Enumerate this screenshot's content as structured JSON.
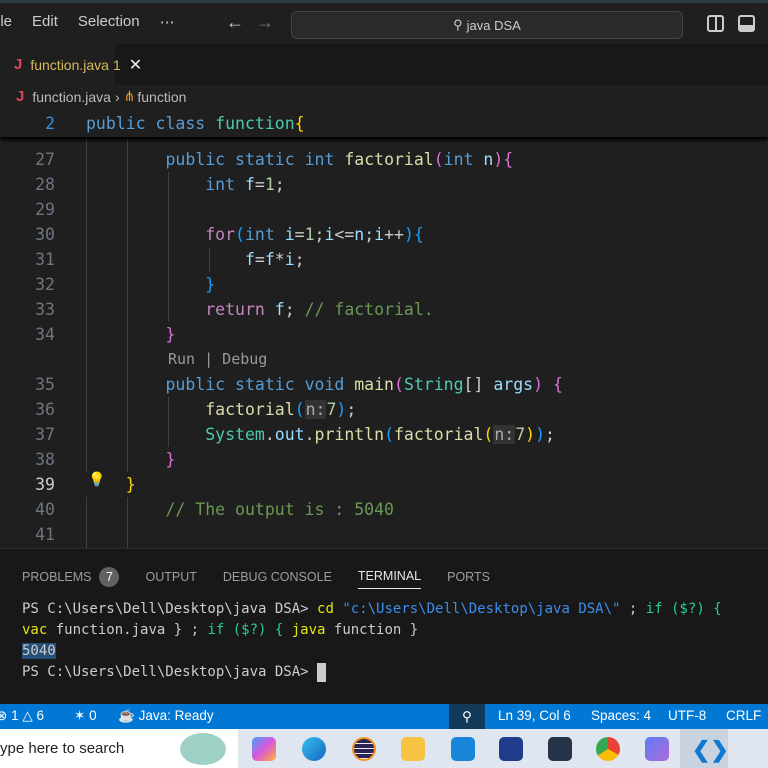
{
  "menu": [
    "ile",
    "Edit",
    "Selection",
    "⋯"
  ],
  "search": "java DSA",
  "tab": {
    "icon": "J",
    "name": "function.java",
    "problems": "1",
    "close": "✕"
  },
  "breadcrumb": {
    "file": "function.java",
    "symbol": "function"
  },
  "sticky": {
    "ln": "2",
    "tokens": [
      [
        "public ",
        "k"
      ],
      [
        "class ",
        "k"
      ],
      [
        "function",
        "t"
      ],
      [
        "{",
        "b1"
      ]
    ]
  },
  "lines": [
    {
      "ln": "27",
      "tokens": [
        [
          "        ",
          ""
        ],
        [
          "public ",
          "k"
        ],
        [
          "static ",
          "k"
        ],
        [
          "int ",
          "k"
        ],
        [
          "factorial",
          "f"
        ],
        [
          "(",
          "b2"
        ],
        [
          "int ",
          "k"
        ],
        [
          "n",
          "v"
        ],
        [
          ")",
          "b2"
        ],
        [
          "{",
          "b2"
        ]
      ]
    },
    {
      "ln": "28",
      "tokens": [
        [
          "            ",
          ""
        ],
        [
          "int ",
          "k"
        ],
        [
          "f",
          "v"
        ],
        [
          "=",
          ""
        ],
        [
          "1",
          "n"
        ],
        [
          ";",
          ""
        ]
      ]
    },
    {
      "ln": "29",
      "tokens": []
    },
    {
      "ln": "30",
      "tokens": [
        [
          "            ",
          ""
        ],
        [
          "for",
          "c"
        ],
        [
          "(",
          "b3"
        ],
        [
          "int ",
          "k"
        ],
        [
          "i",
          "v"
        ],
        [
          "=",
          ""
        ],
        [
          "1",
          "n"
        ],
        [
          ";",
          ""
        ],
        [
          "i",
          "v"
        ],
        [
          "<=",
          ""
        ],
        [
          "n",
          "v"
        ],
        [
          ";",
          ""
        ],
        [
          "i",
          "v"
        ],
        [
          "++",
          ""
        ],
        [
          ")",
          "b3"
        ],
        [
          "{",
          "b3"
        ]
      ]
    },
    {
      "ln": "31",
      "tokens": [
        [
          "                ",
          ""
        ],
        [
          "f",
          "v"
        ],
        [
          "=",
          ""
        ],
        [
          "f",
          "v"
        ],
        [
          "*",
          ""
        ],
        [
          "i",
          "v"
        ],
        [
          ";",
          ""
        ]
      ]
    },
    {
      "ln": "32",
      "tokens": [
        [
          "            ",
          ""
        ],
        [
          "}",
          "b3"
        ]
      ]
    },
    {
      "ln": "33",
      "tokens": [
        [
          "            ",
          ""
        ],
        [
          "return ",
          "c"
        ],
        [
          "f",
          "v"
        ],
        [
          "; ",
          ""
        ],
        [
          "// factorial.",
          "cm"
        ]
      ]
    },
    {
      "ln": "34",
      "tokens": [
        [
          "        ",
          ""
        ],
        [
          "}",
          "b2"
        ]
      ]
    },
    {
      "ln": "35",
      "tokens": [
        [
          "        ",
          ""
        ],
        [
          "public ",
          "k"
        ],
        [
          "static ",
          "k"
        ],
        [
          "void ",
          "k"
        ],
        [
          "main",
          "f"
        ],
        [
          "(",
          "b2"
        ],
        [
          "String",
          "t"
        ],
        [
          "[] ",
          ""
        ],
        [
          "args",
          "v"
        ],
        [
          ") ",
          "b2"
        ],
        [
          "{",
          "b2"
        ]
      ]
    },
    {
      "ln": "36",
      "tokens": [
        [
          "            ",
          ""
        ],
        [
          "factorial",
          "f"
        ],
        [
          "(",
          "b3"
        ],
        [
          "n:",
          "hint"
        ],
        [
          "7",
          "n"
        ],
        [
          ")",
          "b3"
        ],
        [
          ";",
          ""
        ]
      ]
    },
    {
      "ln": "37",
      "tokens": [
        [
          "            ",
          ""
        ],
        [
          "System",
          "t"
        ],
        [
          ".",
          ""
        ],
        [
          "out",
          "v"
        ],
        [
          ".",
          ""
        ],
        [
          "println",
          "f"
        ],
        [
          "(",
          "b3"
        ],
        [
          "factorial",
          "f"
        ],
        [
          "(",
          "b1"
        ],
        [
          "n:",
          "hint"
        ],
        [
          "7",
          "n"
        ],
        [
          ")",
          "b1"
        ],
        [
          ")",
          "b3"
        ],
        [
          ";",
          ""
        ]
      ]
    },
    {
      "ln": "38",
      "tokens": [
        [
          "        ",
          ""
        ],
        [
          "}",
          "b2"
        ]
      ]
    },
    {
      "ln": "39",
      "tokens": [
        [
          "    ",
          ""
        ],
        [
          "}",
          "b1"
        ]
      ]
    },
    {
      "ln": "40",
      "tokens": [
        [
          "        ",
          ""
        ],
        [
          "// The output is : 5040",
          "cm"
        ]
      ]
    },
    {
      "ln": "41",
      "tokens": []
    }
  ],
  "codelens": "Run | Debug",
  "panel": {
    "tabs": [
      "PROBLEMS",
      "OUTPUT",
      "DEBUG CONSOLE",
      "TERMINAL",
      "PORTS"
    ],
    "problems_count": "7"
  },
  "terminal": {
    "prompt": "PS C:\\Users\\Dell\\Desktop\\java DSA> ",
    "cmd1": "cd ",
    "path": "\"c:\\Users\\Dell\\Desktop\\java DSA\\\"",
    "semi": " ; ",
    "if1": "if ($?) {",
    "vac": "vac",
    "javac_arg": " function.java } ; ",
    "if2": "if ($?) { ",
    "java": "java",
    "java_arg": " function }",
    "output": "5040"
  },
  "status": {
    "errors": "1",
    "warnings": "6",
    "ports": "0",
    "java": "Java: Ready",
    "position": "Ln 39, Col 6",
    "spaces": "Spaces: 4",
    "encoding": "UTF-8",
    "eol": "CRLF"
  },
  "taskbar": {
    "search_placeholder": "ype here to search"
  }
}
